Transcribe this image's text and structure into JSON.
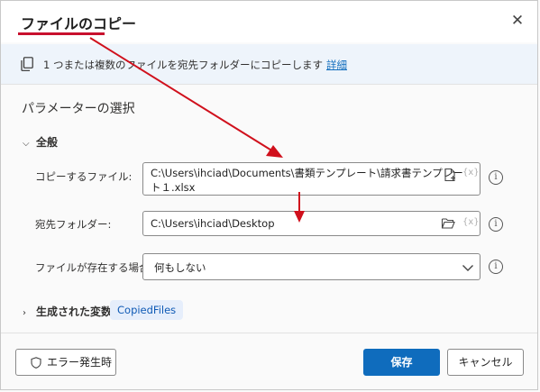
{
  "dialog": {
    "title": "ファイルのコピー",
    "close_icon": "close-icon"
  },
  "info": {
    "icon": "copy-icon",
    "text": "1 つまたは複数のファイルを宛先フォルダーにコピーします",
    "link": "詳細"
  },
  "section": {
    "title": "パラメーターの選択",
    "group_label": "全般"
  },
  "fields": {
    "file": {
      "label": "コピーするファイル:",
      "value_line1": "C:\\Users\\ihciad\\Documents\\書類テンプレート\\請求書テンプレー",
      "value_line2": "ト１.xlsx",
      "var_symbol": "{x}"
    },
    "folder": {
      "label": "宛先フォルダー:",
      "value": "C:\\Users\\ihciad\\Desktop",
      "var_symbol": "{x}"
    },
    "exists": {
      "label": "ファイルが存在する場合:",
      "value": "何もしない"
    }
  },
  "generated": {
    "label": "生成された変数",
    "chip": "CopiedFiles"
  },
  "footer": {
    "error_button": "エラー発生時",
    "save_button": "保存",
    "cancel_button": "キャンセル"
  },
  "colors": {
    "primary": "#0f6cbd",
    "annotation_red": "#c8102e",
    "info_bg": "#eef4fb",
    "chip_bg": "#e6eefb"
  }
}
